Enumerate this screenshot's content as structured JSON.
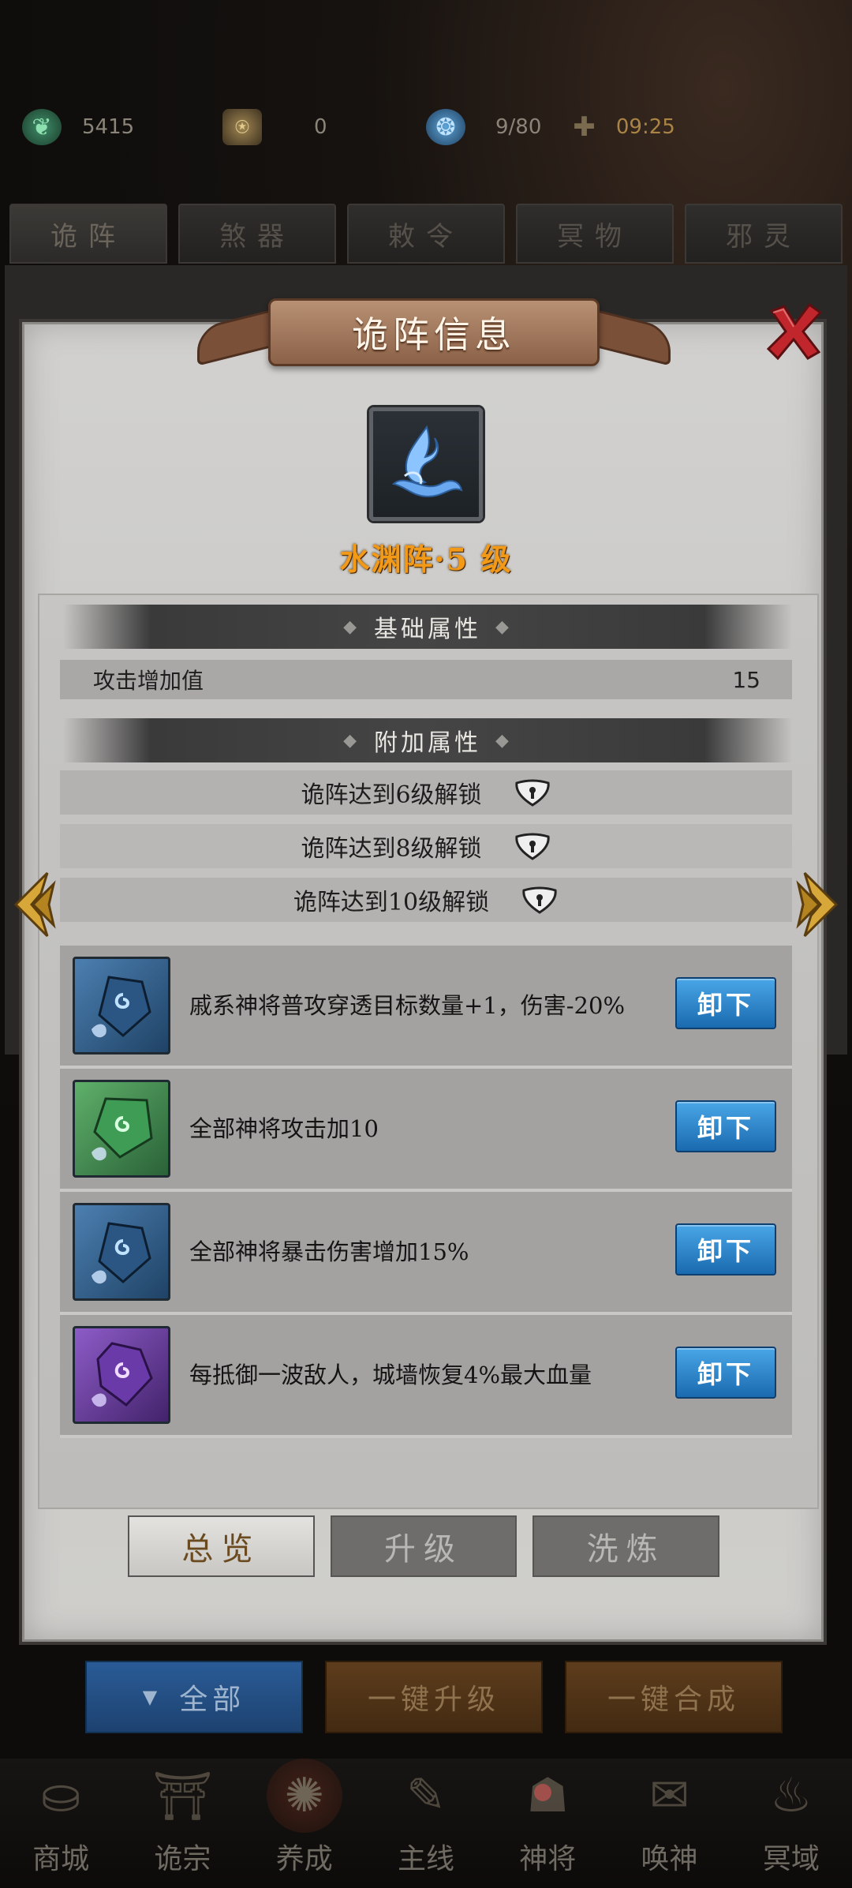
{
  "resources": {
    "jade": "5415",
    "bell": "0",
    "stamina": "9/80",
    "timer": "09:25"
  },
  "category_tabs": [
    "诡阵",
    "煞器",
    "敕令",
    "冥物",
    "邪灵"
  ],
  "panel": {
    "title": "诡阵信息",
    "formation_name": "水渊阵·5 级",
    "basic_section": "基础属性",
    "basic_stat": {
      "label": "攻击增加值",
      "value": "15"
    },
    "extra_section": "附加属性",
    "locks": [
      "诡阵达到6级解锁",
      "诡阵达到8级解锁",
      "诡阵达到10级解锁"
    ],
    "effects": [
      {
        "color": "blue",
        "text": "戚系神将普攻穿透目标数量+1，伤害-20%",
        "button": "卸下"
      },
      {
        "color": "green",
        "text": "全部神将攻击加10",
        "button": "卸下"
      },
      {
        "color": "blue",
        "text": "全部神将暴击伤害增加15%",
        "button": "卸下"
      },
      {
        "color": "purple",
        "text": "每抵御一波敌人，城墙恢复4%最大血量",
        "button": "卸下"
      }
    ]
  },
  "sub_tabs": [
    "总览",
    "升级",
    "洗炼"
  ],
  "actions": {
    "filter": "全部",
    "upgrade_all": "一键升级",
    "merge_all": "一键合成"
  },
  "bottom_nav": [
    "商城",
    "诡宗",
    "养成",
    "主线",
    "神将",
    "唤神",
    "冥域"
  ]
}
